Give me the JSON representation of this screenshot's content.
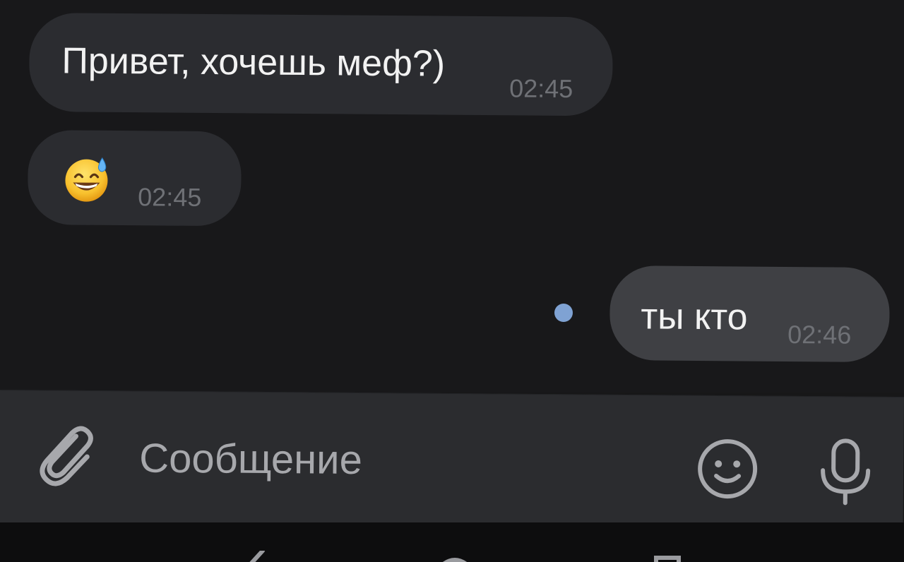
{
  "messages": [
    {
      "direction": "incoming",
      "text": "Привет, хочешь меф?)",
      "time": "02:45"
    },
    {
      "direction": "incoming",
      "text": "",
      "emoji": "grinning-face-with-sweat",
      "time": "02:45"
    },
    {
      "direction": "outgoing",
      "text": "ты кто",
      "time": "02:46",
      "status": "unread-dot"
    }
  ],
  "composer": {
    "placeholder": "Сообщение",
    "icons": {
      "attach": "paperclip-icon",
      "emoji": "smiley-icon",
      "mic": "microphone-icon"
    }
  },
  "colors": {
    "background": "#18181a",
    "incoming_bubble": "#2b2c30",
    "outgoing_bubble": "#3f4044",
    "unread_dot": "#7fa2d3",
    "time": "#6f7176",
    "composer": "#2b2c2f"
  },
  "navigation": {
    "buttons": [
      "back-icon",
      "home-icon",
      "recent-apps-icon"
    ]
  }
}
